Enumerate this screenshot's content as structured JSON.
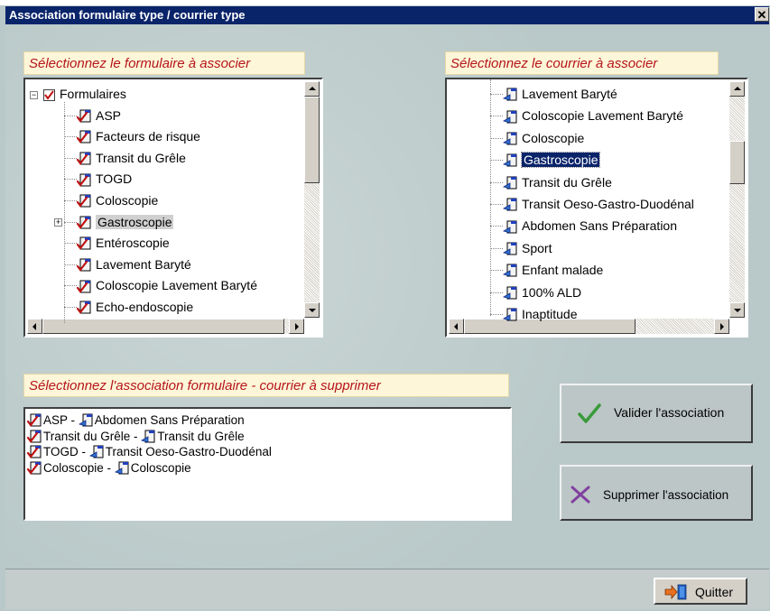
{
  "window": {
    "title": "Association formulaire type / courrier type",
    "close_glyph": "✕"
  },
  "left_panel": {
    "label": "Sélectionnez le formulaire à associer",
    "root": "Formulaires",
    "items": [
      "ASP",
      "Facteurs de risque",
      "Transit du Grêle",
      "TOGD",
      "Coloscopie",
      "Gastroscopie",
      "Entéroscopie",
      "Lavement Baryté",
      "Coloscopie Lavement Baryté",
      "Echo-endoscopie"
    ],
    "selected": "Gastroscopie"
  },
  "right_panel": {
    "label": "Sélectionnez le courrier à associer",
    "items": [
      "Lavement Baryté",
      "Coloscopie Lavement Baryté",
      "Coloscopie",
      "Gastroscopie",
      "Transit du Grêle",
      "Transit Oeso-Gastro-Duodénal",
      "Abdomen Sans Préparation",
      "Sport",
      "Enfant malade",
      "100% ALD",
      "Inaptitude"
    ],
    "selected": "Gastroscopie"
  },
  "assoc_panel": {
    "label": "Sélectionnez l'association formulaire - courrier à supprimer",
    "items": [
      {
        "form": "ASP",
        "letter": "Abdomen Sans Préparation"
      },
      {
        "form": "Transit du Grêle",
        "letter": "Transit du Grêle"
      },
      {
        "form": "TOGD",
        "letter": "Transit Oeso-Gastro-Duodénal"
      },
      {
        "form": "Coloscopie",
        "letter": "Coloscopie"
      }
    ],
    "separator": " - "
  },
  "buttons": {
    "validate": "Valider l'association",
    "delete": "Supprimer l'association",
    "quit": "Quitter"
  },
  "colors": {
    "label_text": "#b5141a",
    "label_bg": "#fdf6d8",
    "title_bg": "#0a246a",
    "validate_icon": "#3a9a3a",
    "delete_icon": "#8040a0"
  }
}
